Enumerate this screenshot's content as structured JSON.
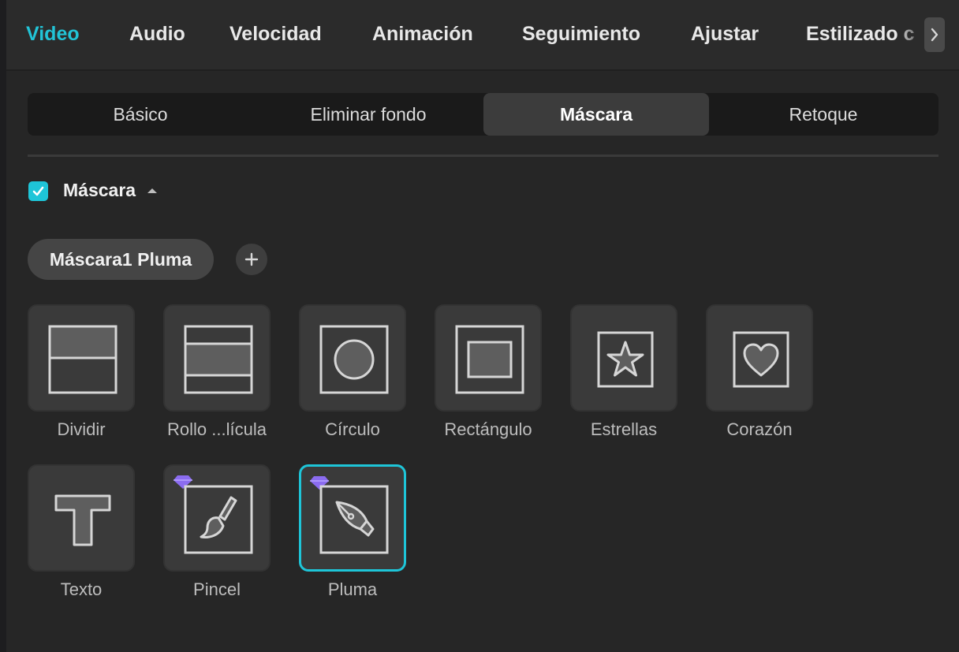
{
  "colors": {
    "accent": "#1ec5d8",
    "active_tab_text": "#22c3d6",
    "panel_bg": "#262626",
    "tile_bg": "#3a3a3a",
    "premium_badge": "#8b6cf0"
  },
  "top_tabs": [
    {
      "label": "Video",
      "active": true
    },
    {
      "label": "Audio",
      "active": false
    },
    {
      "label": "Velocidad",
      "active": false
    },
    {
      "label": "Animación",
      "active": false
    },
    {
      "label": "Seguimiento",
      "active": false
    },
    {
      "label": "Ajustar",
      "active": false
    },
    {
      "label": "Estilizado c",
      "active": false
    }
  ],
  "tab_scroll_icon": "chevron-right-icon",
  "sub_tabs": [
    {
      "label": "Básico",
      "active": false
    },
    {
      "label": "Eliminar fondo",
      "active": false
    },
    {
      "label": "Máscara",
      "active": true
    },
    {
      "label": "Retoque",
      "active": false
    }
  ],
  "section": {
    "checked": true,
    "title": "Máscara",
    "collapse_icon": "caret-up-icon"
  },
  "masks": {
    "chip_label": "Máscara1 Pluma",
    "add_icon": "plus-icon"
  },
  "mask_shapes": [
    {
      "label": "Dividir",
      "icon": "split-mask-icon",
      "premium": false,
      "selected": false
    },
    {
      "label": "Rollo ...lícula",
      "icon": "film-strip-mask-icon",
      "premium": false,
      "selected": false
    },
    {
      "label": "Círculo",
      "icon": "circle-mask-icon",
      "premium": false,
      "selected": false
    },
    {
      "label": "Rectángulo",
      "icon": "rectangle-mask-icon",
      "premium": false,
      "selected": false
    },
    {
      "label": "Estrellas",
      "icon": "star-mask-icon",
      "premium": false,
      "selected": false
    },
    {
      "label": "Corazón",
      "icon": "heart-mask-icon",
      "premium": false,
      "selected": false
    },
    {
      "label": "Texto",
      "icon": "text-mask-icon",
      "premium": false,
      "selected": false
    },
    {
      "label": "Pincel",
      "icon": "brush-mask-icon",
      "premium": true,
      "selected": false
    },
    {
      "label": "Pluma",
      "icon": "pen-mask-icon",
      "premium": true,
      "selected": true
    }
  ]
}
